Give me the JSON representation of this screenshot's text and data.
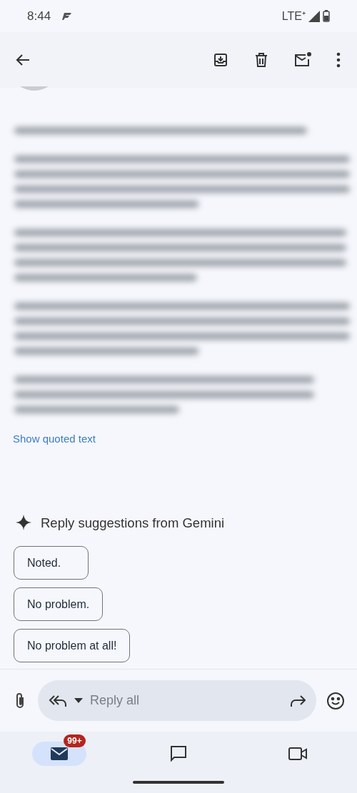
{
  "status_bar": {
    "time": "8:44",
    "network": "LTE⁺"
  },
  "message": {
    "show_quoted": "Show quoted text"
  },
  "suggestions": {
    "title": "Reply suggestions from Gemini",
    "chips": [
      "Noted.",
      "No problem.",
      "No problem at all!"
    ]
  },
  "reply_bar": {
    "placeholder": "Reply all"
  },
  "bottom_nav": [
    {
      "kind": "mail",
      "selected": true,
      "badge": "99+"
    },
    {
      "kind": "chat",
      "selected": false
    },
    {
      "kind": "meet",
      "selected": false
    }
  ]
}
